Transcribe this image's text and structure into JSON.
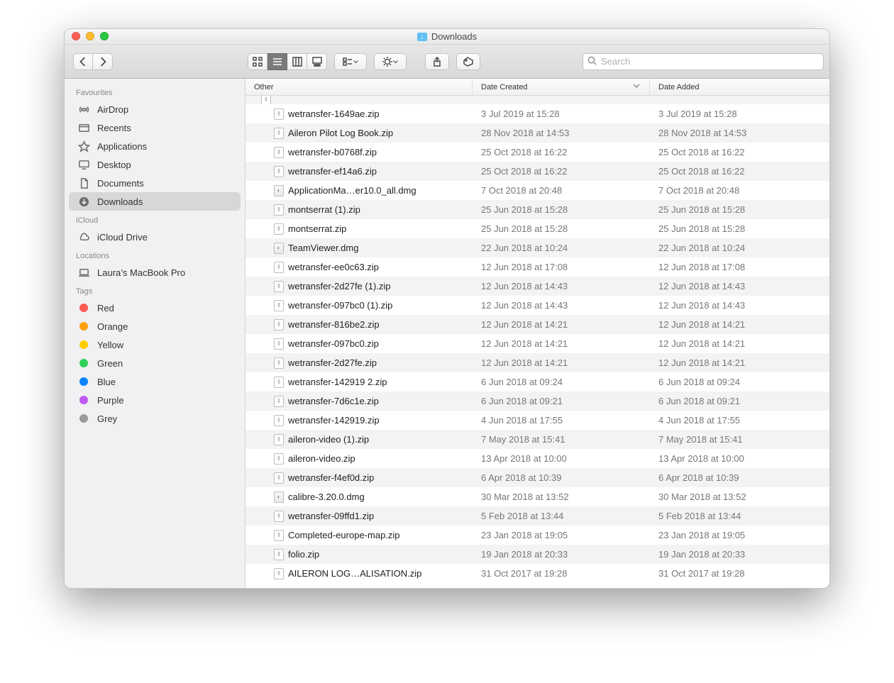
{
  "window": {
    "title": "Downloads"
  },
  "search": {
    "placeholder": "Search"
  },
  "columns": {
    "name": "Other",
    "created": "Date Created",
    "added": "Date Added"
  },
  "sidebar": {
    "sections": [
      {
        "label": "Favourites",
        "items": [
          {
            "icon": "airdrop",
            "label": "AirDrop"
          },
          {
            "icon": "recents",
            "label": "Recents"
          },
          {
            "icon": "apps",
            "label": "Applications"
          },
          {
            "icon": "desktop",
            "label": "Desktop"
          },
          {
            "icon": "docs",
            "label": "Documents"
          },
          {
            "icon": "downloads",
            "label": "Downloads",
            "selected": true
          }
        ]
      },
      {
        "label": "iCloud",
        "items": [
          {
            "icon": "cloud",
            "label": "iCloud Drive"
          }
        ]
      },
      {
        "label": "Locations",
        "items": [
          {
            "icon": "laptop",
            "label": "Laura’s MacBook Pro"
          }
        ]
      },
      {
        "label": "Tags",
        "items": [
          {
            "icon": "tag",
            "color": "#ff5b54",
            "label": "Red"
          },
          {
            "icon": "tag",
            "color": "#ff9f0a",
            "label": "Orange"
          },
          {
            "icon": "tag",
            "color": "#ffcc00",
            "label": "Yellow"
          },
          {
            "icon": "tag",
            "color": "#30d158",
            "label": "Green"
          },
          {
            "icon": "tag",
            "color": "#0a84ff",
            "label": "Blue"
          },
          {
            "icon": "tag",
            "color": "#bf5af2",
            "label": "Purple"
          },
          {
            "icon": "tag",
            "color": "#9a9a9a",
            "label": "Grey"
          }
        ]
      }
    ]
  },
  "files": [
    {
      "type": "zip",
      "name": "wetransfer-1649ae.zip",
      "created": "3 Jul 2019 at 15:28",
      "added": "3 Jul 2019 at 15:28"
    },
    {
      "type": "zip",
      "name": "Aileron Pilot Log Book.zip",
      "created": "28 Nov 2018 at 14:53",
      "added": "28 Nov 2018 at 14:53"
    },
    {
      "type": "zip",
      "name": "wetransfer-b0768f.zip",
      "created": "25 Oct 2018 at 16:22",
      "added": "25 Oct 2018 at 16:22"
    },
    {
      "type": "zip",
      "name": "wetransfer-ef14a6.zip",
      "created": "25 Oct 2018 at 16:22",
      "added": "25 Oct 2018 at 16:22"
    },
    {
      "type": "dmg",
      "name": "ApplicationMa…er10.0_all.dmg",
      "created": "7 Oct 2018 at 20:48",
      "added": "7 Oct 2018 at 20:48"
    },
    {
      "type": "zip",
      "name": "montserrat (1).zip",
      "created": "25 Jun 2018 at 15:28",
      "added": "25 Jun 2018 at 15:28"
    },
    {
      "type": "zip",
      "name": "montserrat.zip",
      "created": "25 Jun 2018 at 15:28",
      "added": "25 Jun 2018 at 15:28"
    },
    {
      "type": "dmg",
      "name": "TeamViewer.dmg",
      "created": "22 Jun 2018 at 10:24",
      "added": "22 Jun 2018 at 10:24"
    },
    {
      "type": "zip",
      "name": "wetransfer-ee0c63.zip",
      "created": "12 Jun 2018 at 17:08",
      "added": "12 Jun 2018 at 17:08"
    },
    {
      "type": "zip",
      "name": "wetransfer-2d27fe (1).zip",
      "created": "12 Jun 2018 at 14:43",
      "added": "12 Jun 2018 at 14:43"
    },
    {
      "type": "zip",
      "name": "wetransfer-097bc0 (1).zip",
      "created": "12 Jun 2018 at 14:43",
      "added": "12 Jun 2018 at 14:43"
    },
    {
      "type": "zip",
      "name": "wetransfer-816be2.zip",
      "created": "12 Jun 2018 at 14:21",
      "added": "12 Jun 2018 at 14:21"
    },
    {
      "type": "zip",
      "name": "wetransfer-097bc0.zip",
      "created": "12 Jun 2018 at 14:21",
      "added": "12 Jun 2018 at 14:21"
    },
    {
      "type": "zip",
      "name": "wetransfer-2d27fe.zip",
      "created": "12 Jun 2018 at 14:21",
      "added": "12 Jun 2018 at 14:21"
    },
    {
      "type": "zip",
      "name": "wetransfer-142919 2.zip",
      "created": "6 Jun 2018 at 09:24",
      "added": "6 Jun 2018 at 09:24"
    },
    {
      "type": "zip",
      "name": "wetransfer-7d6c1e.zip",
      "created": "6 Jun 2018 at 09:21",
      "added": "6 Jun 2018 at 09:21"
    },
    {
      "type": "zip",
      "name": "wetransfer-142919.zip",
      "created": "4 Jun 2018 at 17:55",
      "added": "4 Jun 2018 at 17:55"
    },
    {
      "type": "zip",
      "name": "aileron-video (1).zip",
      "created": "7 May 2018 at 15:41",
      "added": "7 May 2018 at 15:41"
    },
    {
      "type": "zip",
      "name": "aileron-video.zip",
      "created": "13 Apr 2018 at 10:00",
      "added": "13 Apr 2018 at 10:00"
    },
    {
      "type": "zip",
      "name": "wetransfer-f4ef0d.zip",
      "created": "6 Apr 2018 at 10:39",
      "added": "6 Apr 2018 at 10:39"
    },
    {
      "type": "dmg",
      "name": "calibre-3.20.0.dmg",
      "created": "30 Mar 2018 at 13:52",
      "added": "30 Mar 2018 at 13:52"
    },
    {
      "type": "zip",
      "name": "wetransfer-09ffd1.zip",
      "created": "5 Feb 2018 at 13:44",
      "added": "5 Feb 2018 at 13:44"
    },
    {
      "type": "zip",
      "name": "Completed-europe-map.zip",
      "created": "23 Jan 2018 at 19:05",
      "added": "23 Jan 2018 at 19:05"
    },
    {
      "type": "zip",
      "name": "folio.zip",
      "created": "19 Jan 2018 at 20:33",
      "added": "19 Jan 2018 at 20:33"
    },
    {
      "type": "zip",
      "name": "AILERON LOG…ALISATION.zip",
      "created": "31 Oct 2017 at 19:28",
      "added": "31 Oct 2017 at 19:28"
    }
  ]
}
